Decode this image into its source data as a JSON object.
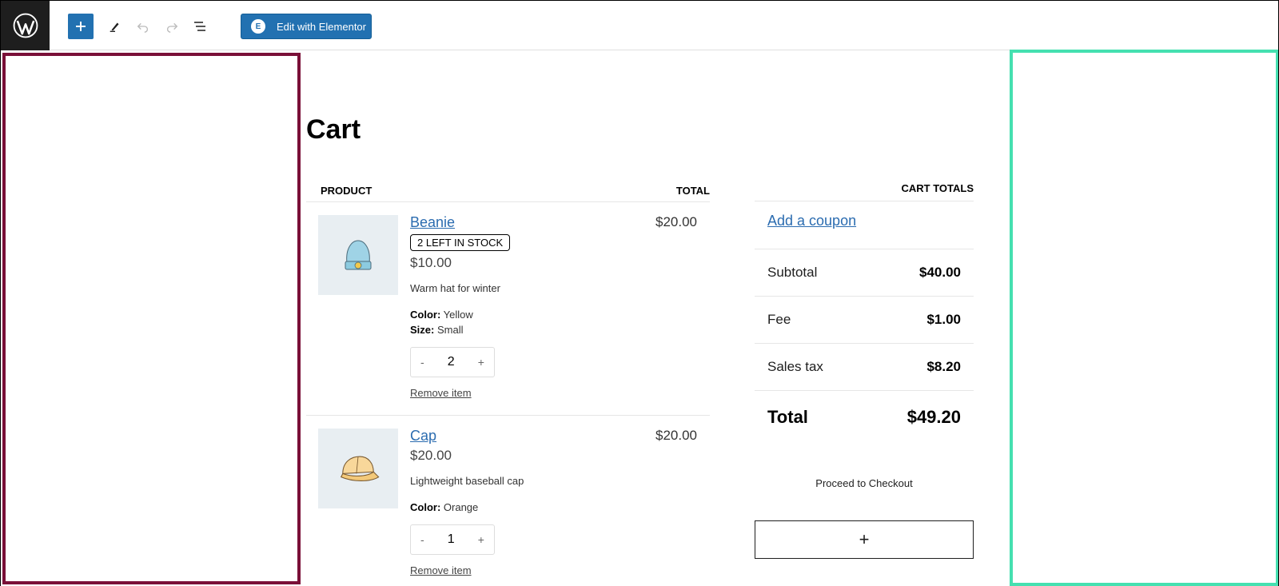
{
  "toolbar": {
    "elementor_label": "Edit with Elementor",
    "elementor_icon": "E"
  },
  "page": {
    "title": "Cart"
  },
  "cart": {
    "headers": {
      "product": "PRODUCT",
      "total": "TOTAL"
    },
    "items": [
      {
        "name": "Beanie",
        "stock": "2 LEFT IN STOCK",
        "price": "$10.00",
        "description": "Warm hat for winter",
        "meta": [
          {
            "key": "Color:",
            "value": "Yellow"
          },
          {
            "key": "Size:",
            "value": "Small"
          }
        ],
        "qty_minus": "-",
        "quantity": "2",
        "qty_plus": "+",
        "remove_label": "Remove item",
        "line_total": "$20.00"
      },
      {
        "name": "Cap",
        "price": "$20.00",
        "description": "Lightweight baseball cap",
        "meta": [
          {
            "key": "Color:",
            "value": "Orange"
          }
        ],
        "qty_minus": "-",
        "quantity": "1",
        "qty_plus": "+",
        "remove_label": "Remove item",
        "line_total": "$20.00"
      }
    ]
  },
  "totals": {
    "heading": "CART TOTALS",
    "coupon_label": "Add a coupon",
    "rows": [
      {
        "label": "Subtotal",
        "value": "$40.00"
      },
      {
        "label": "Fee",
        "value": "$1.00"
      },
      {
        "label": "Sales tax",
        "value": "$8.20"
      }
    ],
    "total_label": "Total",
    "total_value": "$49.20",
    "checkout_label": "Proceed to Checkout",
    "add_block_symbol": "+"
  },
  "colors": {
    "wp_blue": "#2271b1",
    "left_highlight": "#7a1038",
    "right_highlight": "#45e0b0",
    "link": "#2b6cb0"
  }
}
